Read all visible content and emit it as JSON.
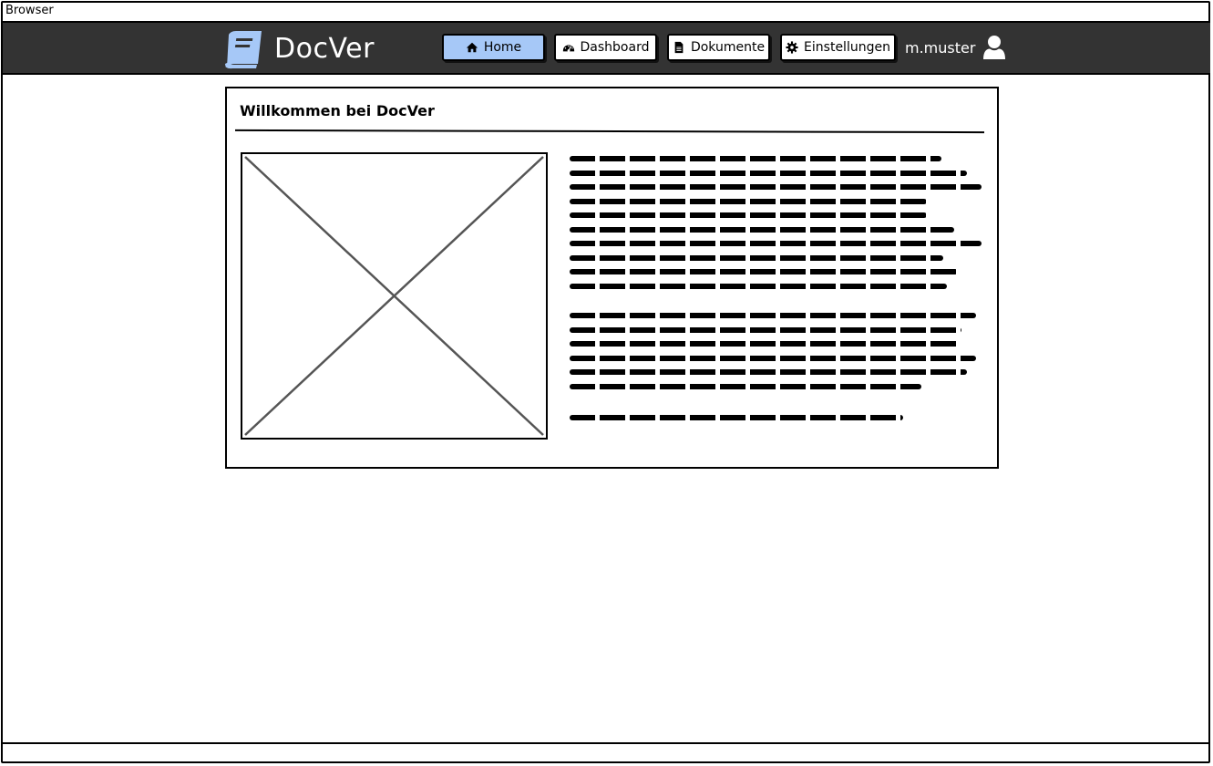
{
  "browser": {
    "title": "Browser"
  },
  "brand": {
    "name": "DocVer",
    "logo_icon": "book-icon",
    "logo_color": "#a6c8f7"
  },
  "nav": {
    "items": [
      {
        "label": "Home",
        "icon": "home-icon",
        "active": true
      },
      {
        "label": "Dashboard",
        "icon": "dashboard-icon",
        "active": false
      },
      {
        "label": "Dokumente",
        "icon": "document-icon",
        "active": false
      },
      {
        "label": "Einstellungen",
        "icon": "gear-icon",
        "active": false
      }
    ],
    "active_color": "#a6c8f7",
    "background_color": "#333333"
  },
  "user": {
    "name": "m.muster",
    "icon": "user-icon"
  },
  "panel": {
    "title": "Willkommen bei DocVer",
    "image_icon": "image-placeholder"
  }
}
